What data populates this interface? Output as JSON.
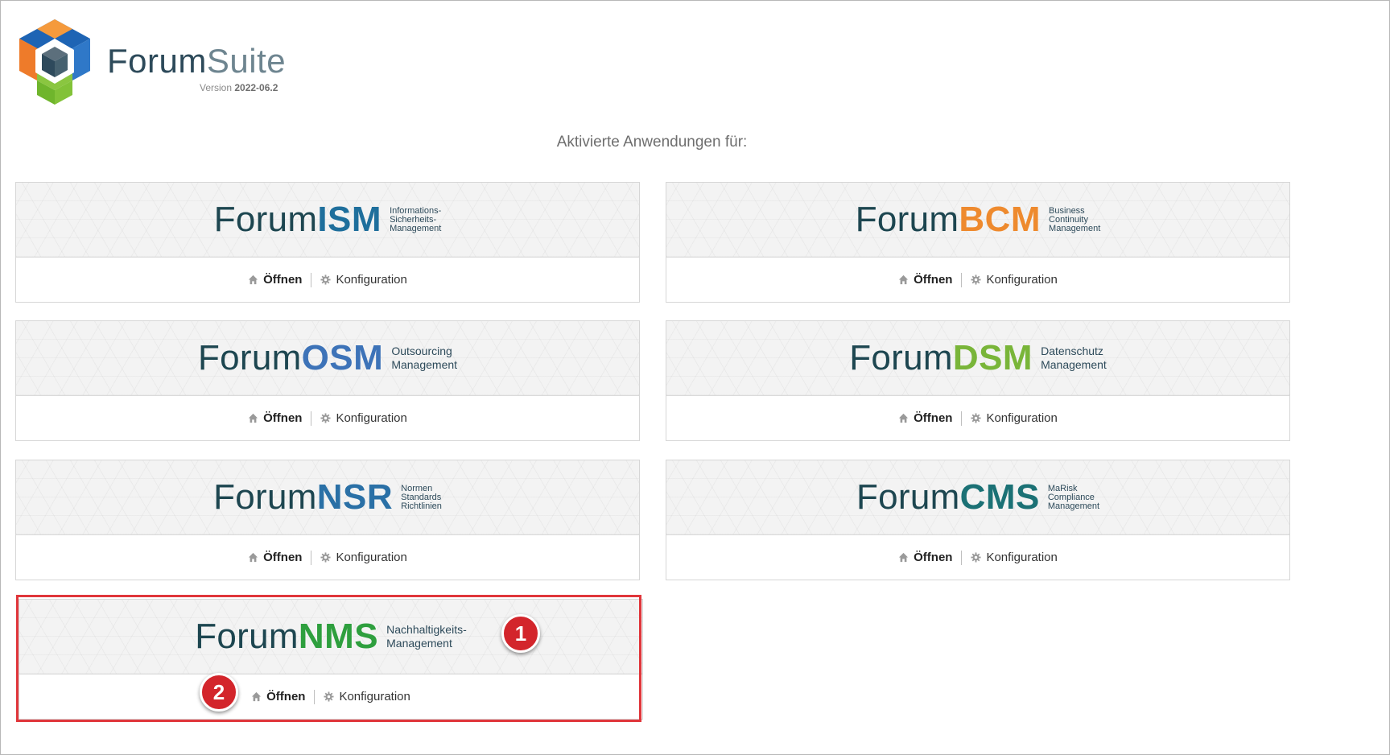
{
  "header": {
    "brand_part1": "Forum",
    "brand_part2": "Suite",
    "version_prefix": "Version ",
    "version_number": "2022-06.2"
  },
  "subtitle": "Aktivierte Anwendungen für:",
  "actions": {
    "open": "Öffnen",
    "config": "Konfiguration"
  },
  "colors": {
    "word": "#1d4650",
    "highlight": "#e0363b",
    "badge": "#d3252b"
  },
  "apps": [
    {
      "word": "Forum",
      "acronym": "ISM",
      "color": "#1f6f9c",
      "desc": [
        "Informations-",
        "Sicherheits-",
        "Management"
      ]
    },
    {
      "word": "Forum",
      "acronym": "BCM",
      "color": "#ee8a2e",
      "desc": [
        "Business",
        "Continuity",
        "Management"
      ]
    },
    {
      "word": "Forum",
      "acronym": "OSM",
      "color": "#3d73b8",
      "desc": [
        "Outsourcing",
        "Management"
      ]
    },
    {
      "word": "Forum",
      "acronym": "DSM",
      "color": "#79b539",
      "desc": [
        "Datenschutz",
        "Management"
      ]
    },
    {
      "word": "Forum",
      "acronym": "NSR",
      "color": "#2a70a6",
      "desc": [
        "Normen",
        "Standards",
        "Richtlinien"
      ]
    },
    {
      "word": "Forum",
      "acronym": "CMS",
      "color": "#1b7175",
      "desc": [
        "MaRisk",
        "Compliance",
        "Management"
      ]
    },
    {
      "word": "Forum",
      "acronym": "NMS",
      "color": "#2e9f3e",
      "desc": [
        "Nachhaltigkeits-",
        "Management"
      ]
    }
  ],
  "badges": [
    "1",
    "2"
  ]
}
